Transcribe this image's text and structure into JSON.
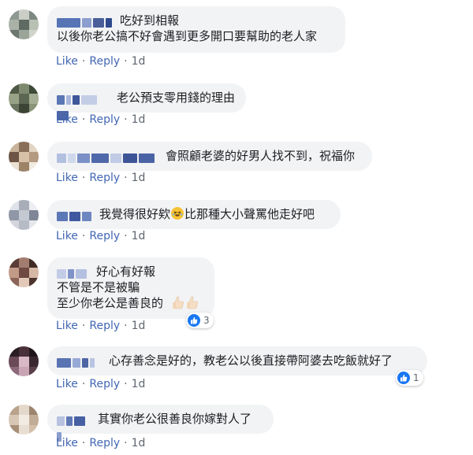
{
  "comments": [
    {
      "text_lines": [
        "吃好到相報",
        "以後你老公搞不好會遇到更多開口要幫助的老人家"
      ],
      "actions": {
        "like": "Like",
        "reply": "Reply",
        "time": "1d"
      }
    },
    {
      "text_lines": [
        "老公預支零用錢的理由"
      ],
      "actions": {
        "like": "Like",
        "reply": "Reply",
        "time": "1d"
      }
    },
    {
      "text_lines": [
        "會照顧老婆的好男人找不到，祝福你"
      ],
      "actions": {
        "like": "Like",
        "reply": "Reply",
        "time": "1d"
      }
    },
    {
      "text_lines": [
        "我覺得很好欸",
        "比那種大小聲罵他走好吧"
      ],
      "emoji": "laughing-emoji",
      "actions": {
        "like": "Like",
        "reply": "Reply",
        "time": "1d"
      }
    },
    {
      "text_lines": [
        "好心有好報",
        "不管是不是被騙",
        "至少你老公是善良的"
      ],
      "emoji": "thumbs-up-emoji",
      "reaction_count": "3",
      "actions": {
        "like": "Like",
        "reply": "Reply",
        "time": "1d"
      }
    },
    {
      "text_lines": [
        "心存善念是好的，教老公以後直接帶阿婆去吃飯就好了"
      ],
      "reaction_count": "1",
      "actions": {
        "like": "Like",
        "reply": "Reply",
        "time": "1d"
      }
    },
    {
      "text_lines": [
        "其實你老公很善良你嫁對人了"
      ],
      "actions": {
        "like": "Like",
        "reply": "Reply",
        "time": "1d"
      }
    }
  ],
  "colors": {
    "bubble": "#f2f3f5",
    "link": "#4267b2",
    "meta": "#606770",
    "like_badge": "#1877f2"
  }
}
